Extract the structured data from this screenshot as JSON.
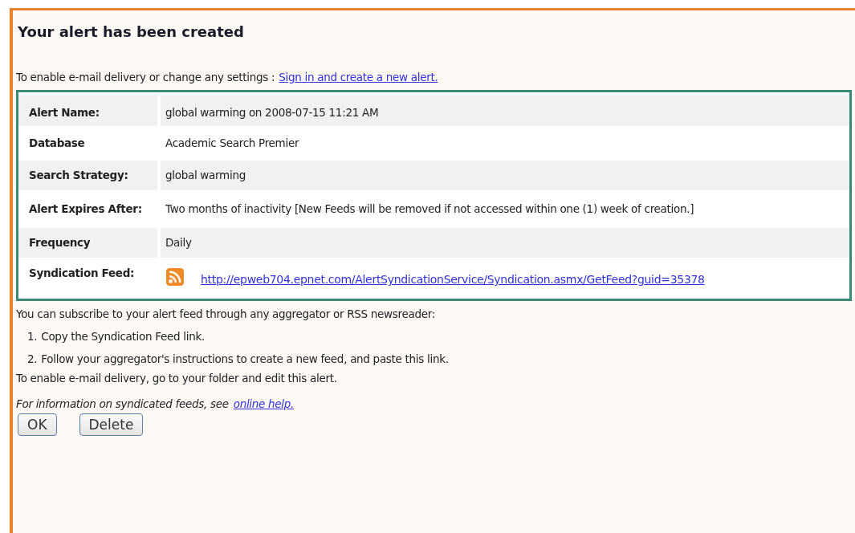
{
  "title": "Your alert has been created",
  "intro": {
    "text": "To enable e-mail delivery or change any settings :",
    "link": "Sign in and create a new alert."
  },
  "details": [
    {
      "kind": "text",
      "label": "Alert Name:",
      "value": "global warming on 2008-07-15 11:21 AM"
    },
    {
      "kind": "text",
      "label": "Database",
      "value": "Academic Search Premier"
    },
    {
      "kind": "text",
      "label": "Search Strategy:",
      "value": "global warming"
    },
    {
      "kind": "text",
      "label": "Alert Expires After:",
      "value": "Two months of inactivity [New Feeds will be removed if not accessed within one (1) week of creation.]"
    },
    {
      "kind": "text",
      "label": "Frequency",
      "value": "Daily"
    },
    {
      "kind": "feed",
      "label": "Syndication Feed:",
      "value": "http://epweb704.epnet.com/AlertSyndicationService/Syndication.asmx/GetFeed?guid=35378"
    }
  ],
  "subscribe_text": "You can subscribe to your alert feed through any aggregator or RSS newsreader:",
  "steps": [
    {
      "number": "1.",
      "text": "Copy the Syndication Feed link."
    },
    {
      "number": "2.",
      "text": "Follow your aggregator's instructions to create a new feed, and paste this link."
    }
  ],
  "email_text": "To enable e-mail delivery, go to your folder and edit this alert.",
  "help": {
    "text": "For information on syndicated feeds, see",
    "link": "online help."
  },
  "buttons": [
    "OK",
    "Delete"
  ]
}
